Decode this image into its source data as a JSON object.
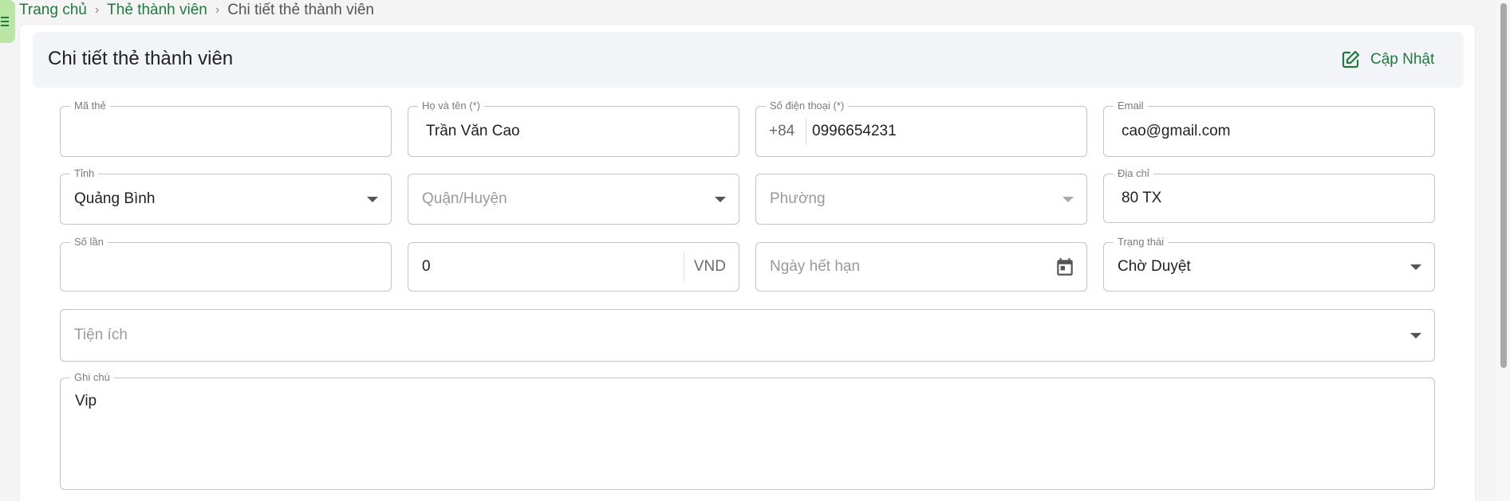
{
  "breadcrumb": {
    "home": "Trang chủ",
    "section": "Thẻ thành viên",
    "current": "Chi tiết thẻ thành viên"
  },
  "header": {
    "title": "Chi tiết thẻ thành viên",
    "update_label": "Cập Nhật"
  },
  "form": {
    "card_code": {
      "label": "Mã thẻ",
      "value": ""
    },
    "full_name": {
      "label": "Họ và tên (*)",
      "value": "Trần Văn Cao"
    },
    "phone": {
      "label": "Số điện thoại (*)",
      "prefix": "+84",
      "value": "0996654231"
    },
    "email": {
      "label": "Email",
      "value": "cao@gmail.com"
    },
    "province": {
      "label": "Tỉnh",
      "value": "Quảng Bình"
    },
    "district": {
      "placeholder": "Quận/Huyện"
    },
    "ward": {
      "placeholder": "Phường"
    },
    "address": {
      "label": "Địa chỉ",
      "value": "80 TX"
    },
    "visits": {
      "label": "Số lần",
      "value": ""
    },
    "amount": {
      "value": "0",
      "unit": "VND"
    },
    "expiry": {
      "placeholder": "Ngày hết hạn"
    },
    "status": {
      "label": "Trạng thái",
      "value": "Chờ Duyệt"
    },
    "amenities": {
      "placeholder": "Tiện ích"
    },
    "notes": {
      "label": "Ghi chú",
      "value": "Vip"
    }
  },
  "icons": {
    "menu": "menu-icon",
    "update": "edit-icon",
    "calendar": "calendar-icon"
  },
  "colors": {
    "accent": "#1f7a3e",
    "menu_tab": "#b9e6a4",
    "header_bg": "#f2f4f7"
  }
}
